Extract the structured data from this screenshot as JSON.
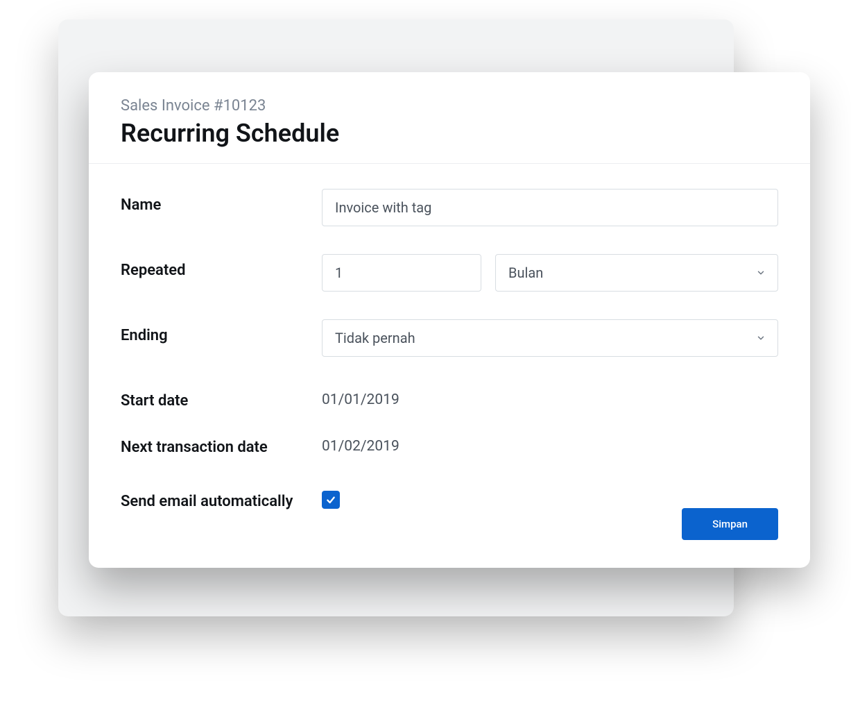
{
  "header": {
    "subtitle": "Sales Invoice #10123",
    "title": "Recurring Schedule"
  },
  "form": {
    "name_label": "Name",
    "name_value": "Invoice with tag",
    "repeated_label": "Repeated",
    "repeated_count": "1",
    "repeated_unit": "Bulan",
    "ending_label": "Ending",
    "ending_value": "Tidak pernah",
    "start_date_label": "Start date",
    "start_date_value": "01/01/2019",
    "next_date_label": "Next transaction date",
    "next_date_value": "01/02/2019",
    "send_email_label": "Send email automatically",
    "send_email_checked": true,
    "save_label": "Simpan"
  }
}
